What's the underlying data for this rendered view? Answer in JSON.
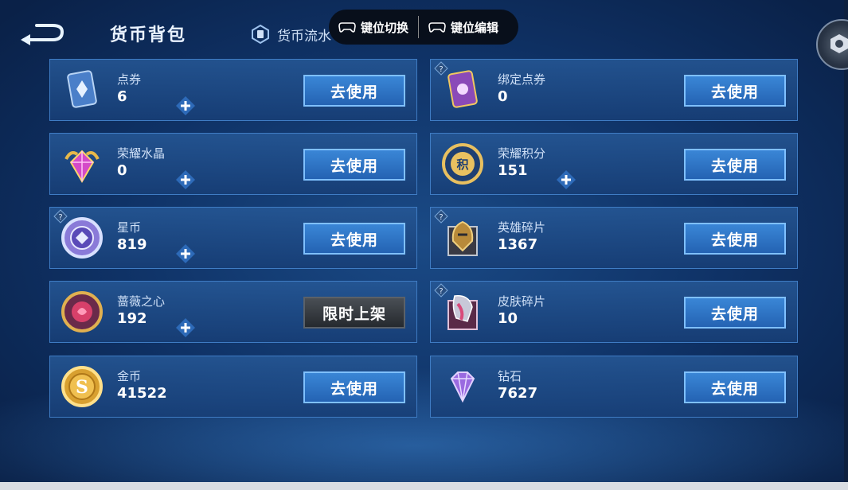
{
  "header": {
    "title": "货币背包",
    "flow_tab_label": "货币流水"
  },
  "overlay": {
    "switch_label": "键位切换",
    "edit_label": "键位编辑"
  },
  "currencies": [
    {
      "name": "点券",
      "value": "6",
      "button": "去使用"
    },
    {
      "name": "绑定点券",
      "value": "0",
      "button": "去使用"
    },
    {
      "name": "荣耀水晶",
      "value": "0",
      "button": "去使用"
    },
    {
      "name": "荣耀积分",
      "value": "151",
      "button": "去使用"
    },
    {
      "name": "星币",
      "value": "819",
      "button": "去使用"
    },
    {
      "name": "英雄碎片",
      "value": "1367",
      "button": "去使用"
    },
    {
      "name": "蔷薇之心",
      "value": "192",
      "button": "限时上架"
    },
    {
      "name": "皮肤碎片",
      "value": "10",
      "button": "去使用"
    },
    {
      "name": "金币",
      "value": "41522",
      "button": "去使用"
    },
    {
      "name": "钻石",
      "value": "7627",
      "button": "去使用"
    }
  ],
  "colors": {
    "background": "#0f3266",
    "card": "#1f4f8f",
    "card_border": "#3f7cc4",
    "button": "#2a6dc0",
    "button_border": "#7fc0ff",
    "button_disabled": "#30353b"
  },
  "icons": {
    "back": "back-arrow-icon",
    "flow": "ticket-flow-icon",
    "switch": "gamepad-icon",
    "edit": "gamepad-icon",
    "corner": "hexagon-icon",
    "plus": "plus-icon",
    "help": "question-icon"
  }
}
